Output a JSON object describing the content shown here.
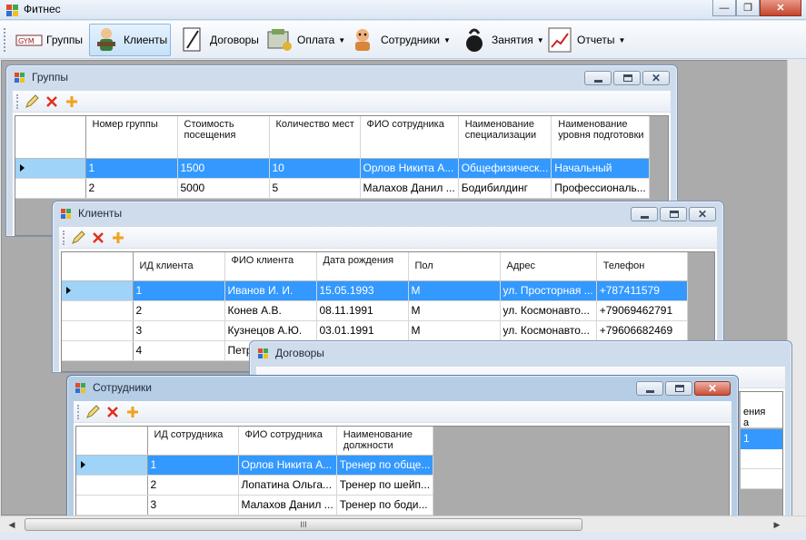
{
  "app": {
    "title": "Фитнес",
    "icon": "app-icon"
  },
  "toolbar": {
    "items": [
      {
        "label": "Группы",
        "icon": "groups-icon",
        "dropdown": false
      },
      {
        "label": "Клиенты",
        "icon": "clients-icon",
        "dropdown": false,
        "active": true
      },
      {
        "label": "Договоры",
        "icon": "contracts-icon",
        "dropdown": false
      },
      {
        "label": "Оплата",
        "icon": "payment-icon",
        "dropdown": true
      },
      {
        "label": "Сотрудники",
        "icon": "employees-icon",
        "dropdown": true
      },
      {
        "label": "Занятия",
        "icon": "kettlebell-icon",
        "dropdown": true
      },
      {
        "label": "Отчеты",
        "icon": "chart-icon",
        "dropdown": true
      }
    ]
  },
  "windows": {
    "groups": {
      "title": "Группы",
      "columns": [
        "Номер группы",
        "Стоимость посещения",
        "Количество мест",
        "ФИО сотрудника",
        "Наименование специализации",
        "Наименование уровня подготовки"
      ],
      "rows": [
        [
          "1",
          "1500",
          "10",
          "Орлов Никита А...",
          "Общефизическ...",
          "Начальный"
        ],
        [
          "2",
          "5000",
          "5",
          "Малахов Данил ...",
          "Бодибилдинг",
          "Профессиональ..."
        ]
      ]
    },
    "clients": {
      "title": "Клиенты",
      "columns": [
        "ИД клиента",
        "ФИО клиента",
        "Дата рождения",
        "Пол",
        "Адрес",
        "Телефон"
      ],
      "rows": [
        [
          "1",
          "Иванов И. И.",
          "15.05.1993",
          "М",
          "ул. Просторная ...",
          "+787411579"
        ],
        [
          "2",
          "Конев А.В.",
          "08.11.1991",
          "М",
          "ул. Космонавто...",
          "+79069462791"
        ],
        [
          "3",
          "Кузнецов А.Ю.",
          "03.01.1991",
          "М",
          "ул. Космонавто...",
          "+79606682469"
        ],
        [
          "4",
          "Петр",
          "",
          "",
          "",
          ""
        ]
      ]
    },
    "contracts": {
      "title": "Договоры",
      "partial_header": "ения\nа",
      "partial_cell": "1"
    },
    "employees": {
      "title": "Сотрудники",
      "columns": [
        "ИД сотрудника",
        "ФИО сотрудника",
        "Наименование должности"
      ],
      "rows": [
        [
          "1",
          "Орлов Никита А...",
          "Тренер по обще..."
        ],
        [
          "2",
          "Лопатина Ольга...",
          "Тренер по шейп..."
        ],
        [
          "3",
          "Малахов Данил ...",
          "Тренер по боди..."
        ]
      ]
    }
  },
  "scrollbar": {
    "grip": "III"
  }
}
